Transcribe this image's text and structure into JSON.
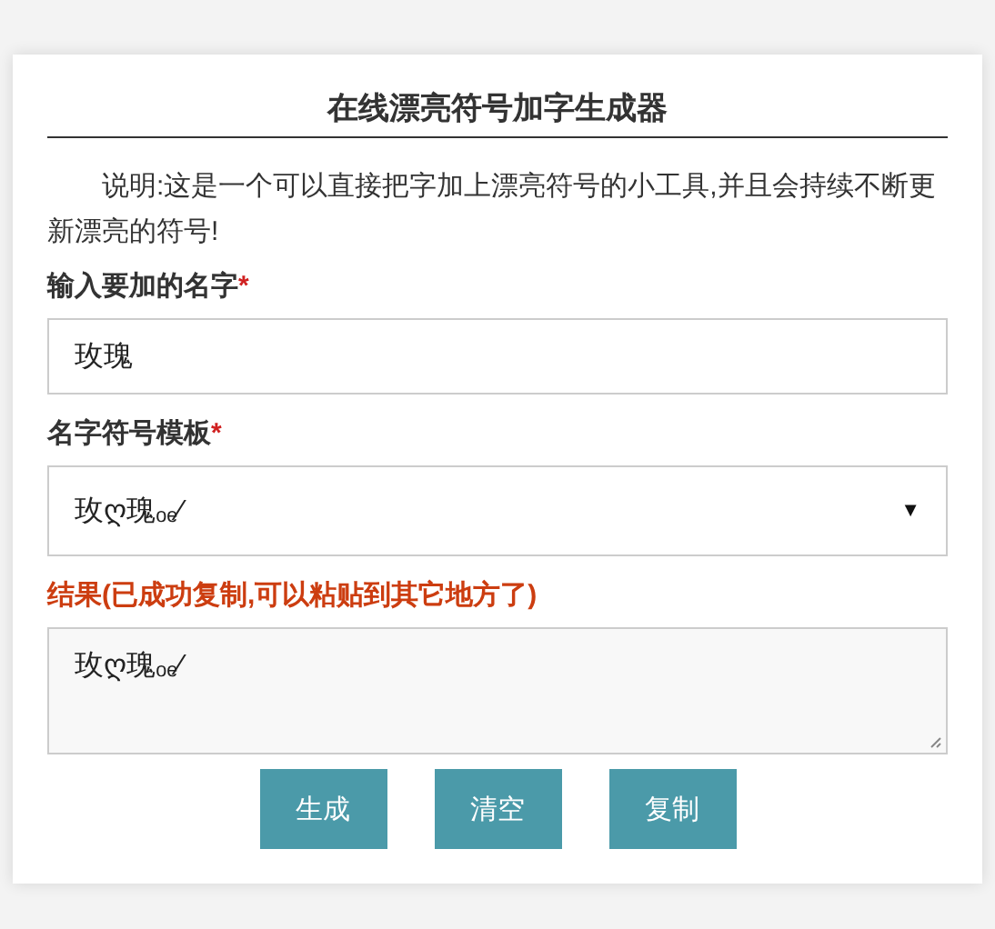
{
  "title": "在线漂亮符号加字生成器",
  "description": "说明:这是一个可以直接把字加上漂亮符号的小工具,并且会持续不断更新漂亮的符号!",
  "fields": [
    {
      "kind": "input",
      "label": "输入要加的名字",
      "required_mark": "*",
      "value": "玫瑰"
    },
    {
      "kind": "select",
      "label": "名字符号模板",
      "required_mark": "*",
      "value": "玫ღ瑰ₒₑ⁄",
      "arrow": "▼"
    },
    {
      "kind": "textarea",
      "label": "结果(已成功复制,可以粘贴到其它地方了)",
      "value": "玫ღ瑰ₒₑ⁄"
    }
  ],
  "buttons": [
    "生成",
    "清空",
    "复制"
  ]
}
